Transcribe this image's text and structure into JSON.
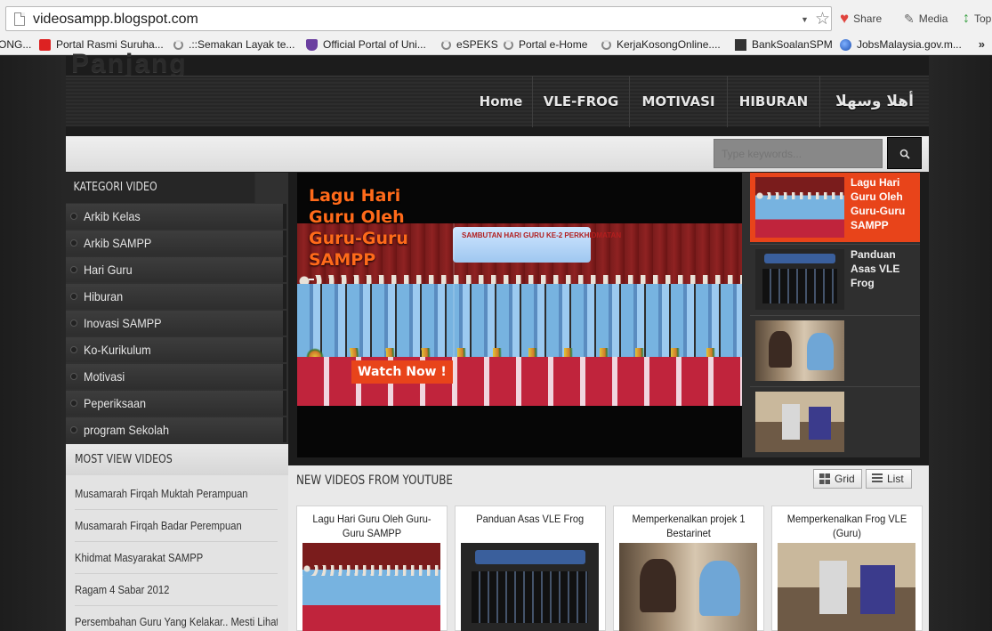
{
  "browser": {
    "url": "videosampp.blogspot.com",
    "share_label": "Share",
    "media_label": "Media",
    "top_label": "Top",
    "bookmarks": [
      "ONG...",
      "Portal Rasmi Suruha...",
      ".::Semakan Layak te...",
      "Official Portal of Uni...",
      "eSPEKS",
      "Portal e-Home",
      "KerjaKosongOnline....",
      "BankSoalanSPM",
      "JobsMalaysia.gov.m..."
    ],
    "more": "»"
  },
  "site": {
    "title": "Panjang",
    "nav": [
      "Home",
      "VLE-FROG",
      "MOTIVASI",
      "HIBURAN",
      "أهلا وسهلا"
    ],
    "search_placeholder": "Type keywords...",
    "search_icon": "search-icon"
  },
  "sidebar": {
    "category_header": "KATEGORI VIDEO",
    "categories": [
      "Arkib Kelas",
      "Arkib SAMPP",
      "Hari Guru",
      "Hiburan",
      "Inovasi SAMPP",
      "Ko-Kurikulum",
      "Motivasi",
      "Peperiksaan",
      "program Sekolah"
    ],
    "most_view_header": "MOST VIEW VIDEOS",
    "most_view": [
      "Musamarah Firqah Muktah Perampuan",
      "Musamarah Firqah Badar Perempuan",
      "Khidmat Masyarakat SAMPP",
      "Ragam 4 Sabar 2012",
      "Persembahan Guru Yang Kelakar.. Mesti Lihat!!"
    ]
  },
  "featured": {
    "title": "Lagu Hari Guru Oleh Guru-Guru SAMPP",
    "banner": "SAMBUTAN HARI GURU KE-2 PERKHIDMATAN",
    "watch_now": "Watch Now !"
  },
  "thumbs": [
    {
      "label": "Lagu Hari Guru Oleh Guru-Guru SAMPP",
      "active": true
    },
    {
      "label": "Panduan Asas VLE Frog",
      "active": false
    },
    {
      "label": "",
      "active": false
    },
    {
      "label": "",
      "active": false
    }
  ],
  "new_videos": {
    "header": "NEW VIDEOS FROM YOUTUBE",
    "grid_label": "Grid",
    "list_label": "List",
    "cards": [
      "Lagu Hari Guru Oleh Guru-Guru SAMPP",
      "Panduan Asas VLE Frog",
      "Memperkenalkan projek 1 Bestarinet",
      "Memperkenalkan Frog VLE (Guru)"
    ]
  },
  "colors": {
    "accent": "#e8441a",
    "title_orange": "#ff6a1a",
    "nav_bg": "#2b2b2b",
    "page_bg": "#1b1b1b"
  }
}
